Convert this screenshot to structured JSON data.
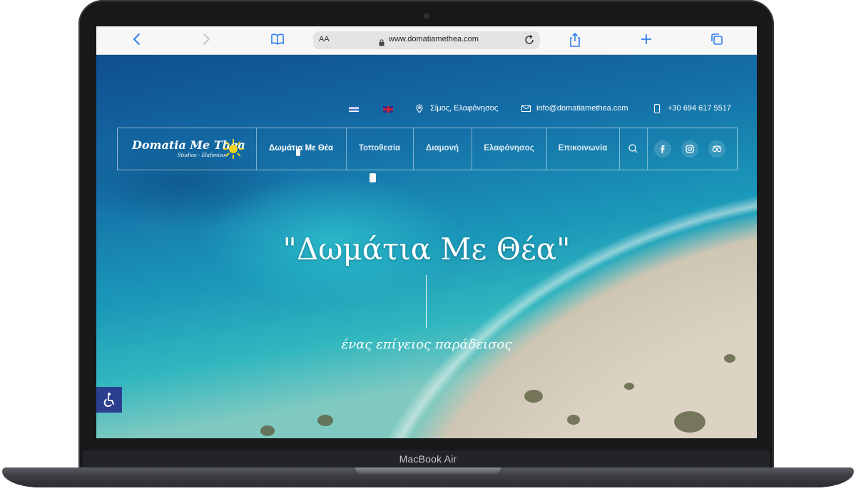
{
  "device": {
    "label": "MacBook Air"
  },
  "browser": {
    "text_size_label": "AA",
    "url": "www.domatiamethea.com",
    "accent_color": "#2f7ef0"
  },
  "site": {
    "logo": {
      "title": "Domatia Me Thea",
      "subtitle": "Studios - Elafonisos"
    },
    "top_bar": {
      "location": "Σίμος, Ελαφόνησος",
      "email": "info@domatiamethea.com",
      "phone": "+30 694 617 5517"
    },
    "nav": [
      {
        "label": "Δωμάτια Με Θέα"
      },
      {
        "label": "Τοποθεσία"
      },
      {
        "label": "Διαμονή"
      },
      {
        "label": "Ελαφόνησος"
      },
      {
        "label": "Επικοινωνία"
      }
    ],
    "hero": {
      "title": "\"Δωμάτια Με Θέα\"",
      "subtitle": "ένας επίγειος παράδεισος"
    },
    "accessibility_color": "#2b3f8f"
  }
}
